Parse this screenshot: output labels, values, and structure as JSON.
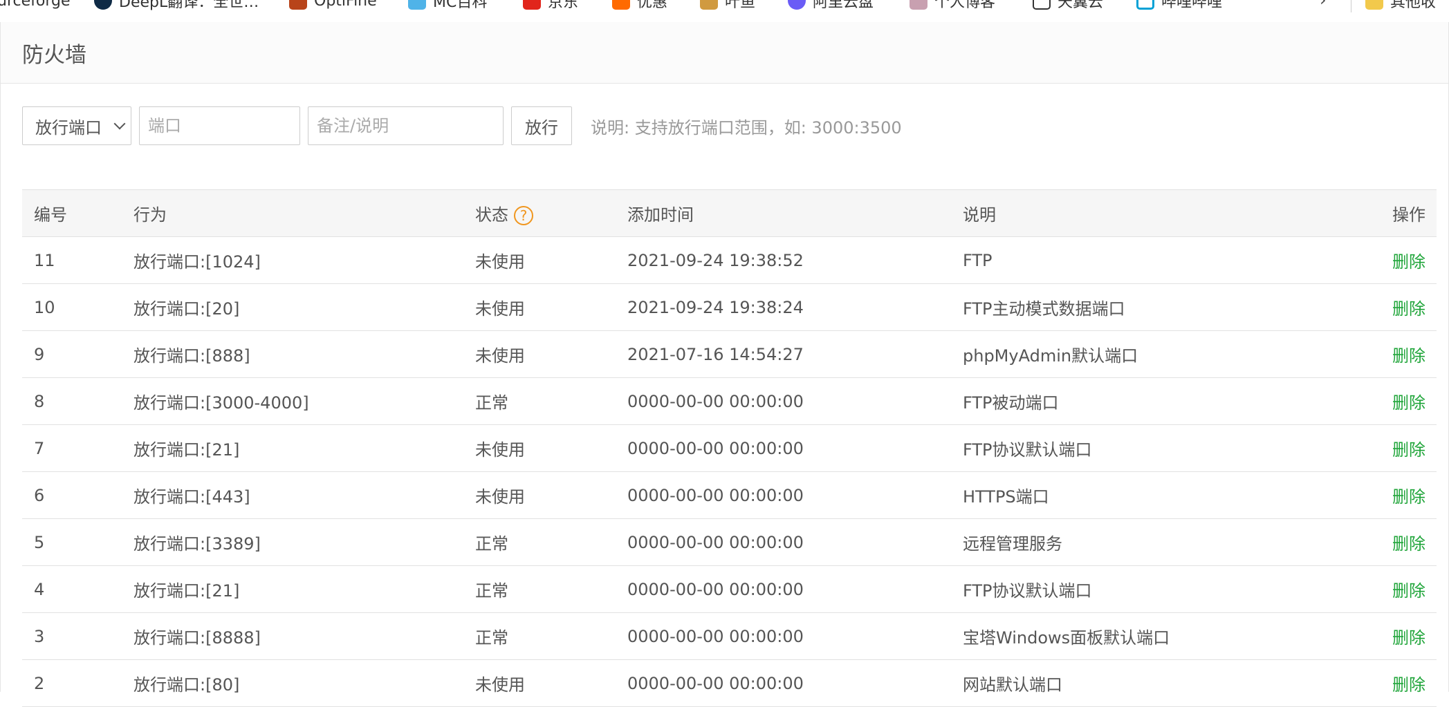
{
  "bookmarks": [
    {
      "label": "urceforge",
      "icon": "sourceforge-icon",
      "color": "#ffffff"
    },
    {
      "label": "DeepL翻译：全世…",
      "icon": "deepl-icon",
      "color": "#0f2b46"
    },
    {
      "label": "OptiFine",
      "icon": "optifine-icon",
      "color": "#b8441a"
    },
    {
      "label": "MC百科",
      "icon": "mcmod-icon",
      "color": "#4fb3e8"
    },
    {
      "label": "京东",
      "icon": "jd-icon",
      "color": "#e1251b"
    },
    {
      "label": "优惠",
      "icon": "coupon-icon",
      "color": "#ff6a00"
    },
    {
      "label": "叶鱼",
      "icon": "fish-icon",
      "color": "#d09a40"
    },
    {
      "label": "阿里云盘",
      "icon": "aliyun-drive-icon",
      "color": "#6a5cf6"
    },
    {
      "label": "个人博客",
      "icon": "blog-icon",
      "color": "#c8a0b0"
    },
    {
      "label": "天翼云",
      "icon": "tianyi-cloud-icon",
      "color": "#333333"
    },
    {
      "label": "哔哩哔哩",
      "icon": "bilibili-icon",
      "color": "#00a1d6"
    }
  ],
  "bookmarks_other": "其他收",
  "page_title": "防火墙",
  "toolbar": {
    "select_value": "放行端口",
    "port_placeholder": "端口",
    "note_placeholder": "备注/说明",
    "submit_label": "放行",
    "hint": "说明: 支持放行端口范围，如: 3000:3500"
  },
  "table": {
    "headers": {
      "id": "编号",
      "action": "行为",
      "status": "状态",
      "added": "添加时间",
      "note": "说明",
      "op": "操作"
    },
    "help_icon": "?",
    "rows": [
      {
        "id": "11",
        "action": "放行端口:[1024]",
        "status": "未使用",
        "added": "2021-09-24 19:38:52",
        "note": "FTP",
        "op": "删除"
      },
      {
        "id": "10",
        "action": "放行端口:[20]",
        "status": "未使用",
        "added": "2021-09-24 19:38:24",
        "note": "FTP主动模式数据端口",
        "op": "删除"
      },
      {
        "id": "9",
        "action": "放行端口:[888]",
        "status": "未使用",
        "added": "2021-07-16 14:54:27",
        "note": "phpMyAdmin默认端口",
        "op": "删除"
      },
      {
        "id": "8",
        "action": "放行端口:[3000-4000]",
        "status": "正常",
        "added": "0000-00-00 00:00:00",
        "note": "FTP被动端口",
        "op": "删除"
      },
      {
        "id": "7",
        "action": "放行端口:[21]",
        "status": "未使用",
        "added": "0000-00-00 00:00:00",
        "note": "FTP协议默认端口",
        "op": "删除"
      },
      {
        "id": "6",
        "action": "放行端口:[443]",
        "status": "未使用",
        "added": "0000-00-00 00:00:00",
        "note": "HTTPS端口",
        "op": "删除"
      },
      {
        "id": "5",
        "action": "放行端口:[3389]",
        "status": "正常",
        "added": "0000-00-00 00:00:00",
        "note": "远程管理服务",
        "op": "删除"
      },
      {
        "id": "4",
        "action": "放行端口:[21]",
        "status": "正常",
        "added": "0000-00-00 00:00:00",
        "note": "FTP协议默认端口",
        "op": "删除"
      },
      {
        "id": "3",
        "action": "放行端口:[8888]",
        "status": "正常",
        "added": "0000-00-00 00:00:00",
        "note": "宝塔Windows面板默认端口",
        "op": "删除"
      },
      {
        "id": "2",
        "action": "放行端口:[80]",
        "status": "未使用",
        "added": "0000-00-00 00:00:00",
        "note": "网站默认端口",
        "op": "删除"
      }
    ]
  }
}
